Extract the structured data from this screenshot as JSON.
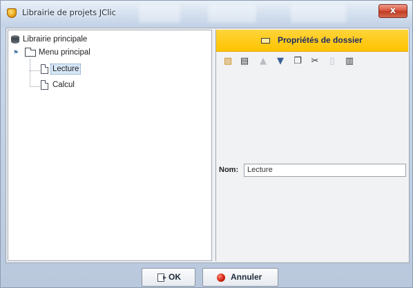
{
  "window": {
    "title": "Librairie de projets JClic",
    "close_glyph": "x"
  },
  "tree": {
    "root_label": "Librairie principale",
    "menu_label": "Menu principal",
    "items": [
      {
        "label": "Lecture",
        "selected": true
      },
      {
        "label": "Calcul",
        "selected": false
      }
    ]
  },
  "properties": {
    "header_title": "Propriétés de dossier",
    "name_label": "Nom:",
    "name_value": "Lecture",
    "toolbar": {
      "icons": [
        "folder-open-icon",
        "new-folder-icon",
        "move-up-icon",
        "move-down-icon",
        "copy-icon",
        "cut-icon",
        "paste-icon",
        "delete-icon"
      ]
    }
  },
  "buttons": {
    "ok_label": "OK",
    "cancel_label": "Annuler"
  },
  "colors": {
    "header_accent": "#ffc400",
    "selection": "#d7e7f8",
    "close_button": "#d8533c"
  }
}
